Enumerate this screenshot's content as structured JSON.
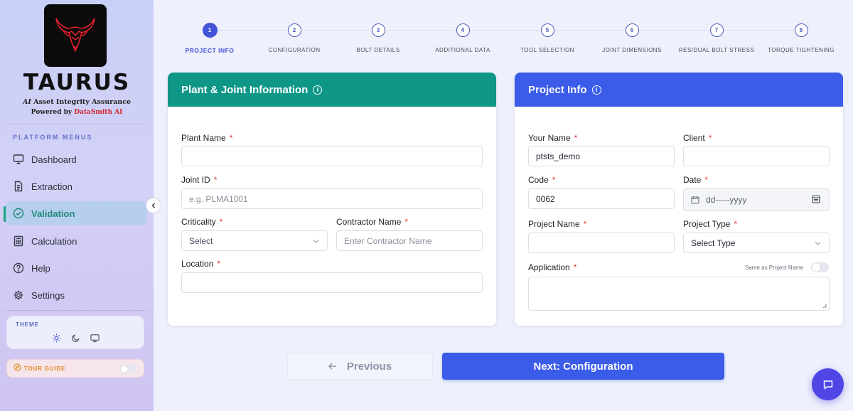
{
  "brand": {
    "name": "TAURUS",
    "tagline_prefix": "AI",
    "tagline_rest": " Asset Integrity Assurance",
    "powered_by": "Powered by",
    "powered_company": "DataSmith AI"
  },
  "sidebar": {
    "menu_title": "PLATFORM MENUS",
    "items": [
      {
        "label": "Dashboard",
        "icon": "monitor-icon",
        "active": false
      },
      {
        "label": "Extraction",
        "icon": "document-icon",
        "active": false
      },
      {
        "label": "Validation",
        "icon": "check-circle-icon",
        "active": true
      },
      {
        "label": "Calculation",
        "icon": "calculator-icon",
        "active": false
      },
      {
        "label": "Help",
        "icon": "help-icon",
        "active": false
      },
      {
        "label": "Settings",
        "icon": "gear-icon",
        "active": false
      }
    ],
    "theme_label": "THEME",
    "theme_options": [
      "sun-icon",
      "moon-icon",
      "monitor-icon"
    ],
    "tour_label": "TOUR GUIDE"
  },
  "stepper": [
    {
      "num": "1",
      "label": "PROJECT INFO",
      "active": true
    },
    {
      "num": "2",
      "label": "CONFIGURATION",
      "active": false
    },
    {
      "num": "3",
      "label": "BOLT DETAILS",
      "active": false
    },
    {
      "num": "4",
      "label": "ADDITIONAL DATA",
      "active": false
    },
    {
      "num": "5",
      "label": "TOOL SELECTION",
      "active": false
    },
    {
      "num": "6",
      "label": "JOINT DIMENSIONS",
      "active": false
    },
    {
      "num": "7",
      "label": "RESIDUAL BOLT STRESS",
      "active": false
    },
    {
      "num": "8",
      "label": "TORQUE TIGHTENING",
      "active": false
    }
  ],
  "plant_joint": {
    "title": "Plant & Joint Information",
    "plant_name_label": "Plant Name",
    "plant_name_value": "",
    "joint_id_label": "Joint ID",
    "joint_id_placeholder": "e.g. PLMA1001",
    "criticality_label": "Criticality",
    "criticality_value": "Select",
    "contractor_label": "Contractor Name",
    "contractor_placeholder": "Enter Contractor Name",
    "location_label": "Location",
    "location_value": ""
  },
  "project_info": {
    "title": "Project Info",
    "your_name_label": "Your Name",
    "your_name_value": "ptsts_demo",
    "client_label": "Client",
    "client_value": "",
    "code_label": "Code",
    "code_value": "0062",
    "date_label": "Date",
    "date_placeholder": "dd-----yyyy",
    "project_name_label": "Project Name",
    "project_name_value": "",
    "project_type_label": "Project Type",
    "project_type_value": "Select Type",
    "application_label": "Application",
    "same_as_label": "Same as Project Name",
    "same_as_on": false
  },
  "footer": {
    "previous_label": "Previous",
    "next_label": "Next: Configuration"
  },
  "colors": {
    "accent": "#3a5ce9",
    "teal": "#0e9787",
    "required": "#e23b3b"
  }
}
